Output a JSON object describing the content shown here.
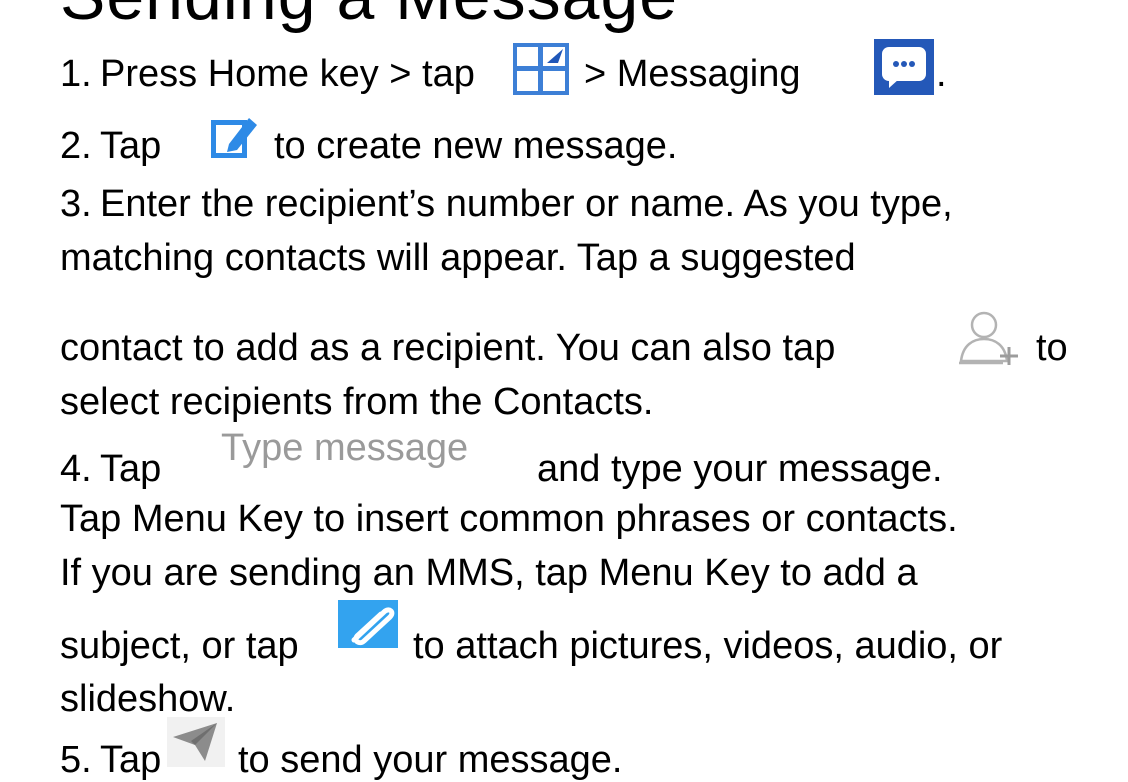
{
  "heading": "Sending a Message",
  "steps": [
    {
      "number": "1.",
      "parts": [
        "Press Home key > tap",
        "> Messaging",
        "."
      ],
      "icons": [
        "apps-grid-icon",
        "messaging-app-icon"
      ]
    },
    {
      "number": "2.",
      "parts": [
        "Tap",
        "to create new message."
      ],
      "icons": [
        "compose-icon"
      ]
    },
    {
      "number": "3.",
      "lines": [
        "Enter the recipient’s number or name. As you type,",
        "matching contacts will appear. Tap a suggested",
        "contact to add as a recipient. You can also tap",
        "to",
        "select recipients from the Contacts."
      ],
      "icons": [
        "add-contact-icon"
      ]
    },
    {
      "number": "4.",
      "parts": [
        "Tap",
        "and type your message."
      ],
      "inline_label": "Type message",
      "lines": [
        "Tap Menu Key to insert common phrases or contacts.",
        "If you are sending an MMS, tap Menu Key to add a",
        "subject, or tap",
        "to attach pictures, videos, audio, or",
        "slideshow."
      ],
      "icons": [
        "attach-paperclip-icon"
      ]
    },
    {
      "number": "5.",
      "parts": [
        "Tap",
        "to send your message."
      ],
      "icons": [
        "send-icon"
      ]
    }
  ],
  "colors": {
    "text": "#000000",
    "muted_label": "#9a9a9a",
    "apps_icon_blue": "#2f6fd0",
    "messaging_icon_blue": "#1a5fc6",
    "compose_blue": "#2e8ae6",
    "attach_blue": "#33a3ef",
    "send_gray": "#8c8c8c"
  }
}
